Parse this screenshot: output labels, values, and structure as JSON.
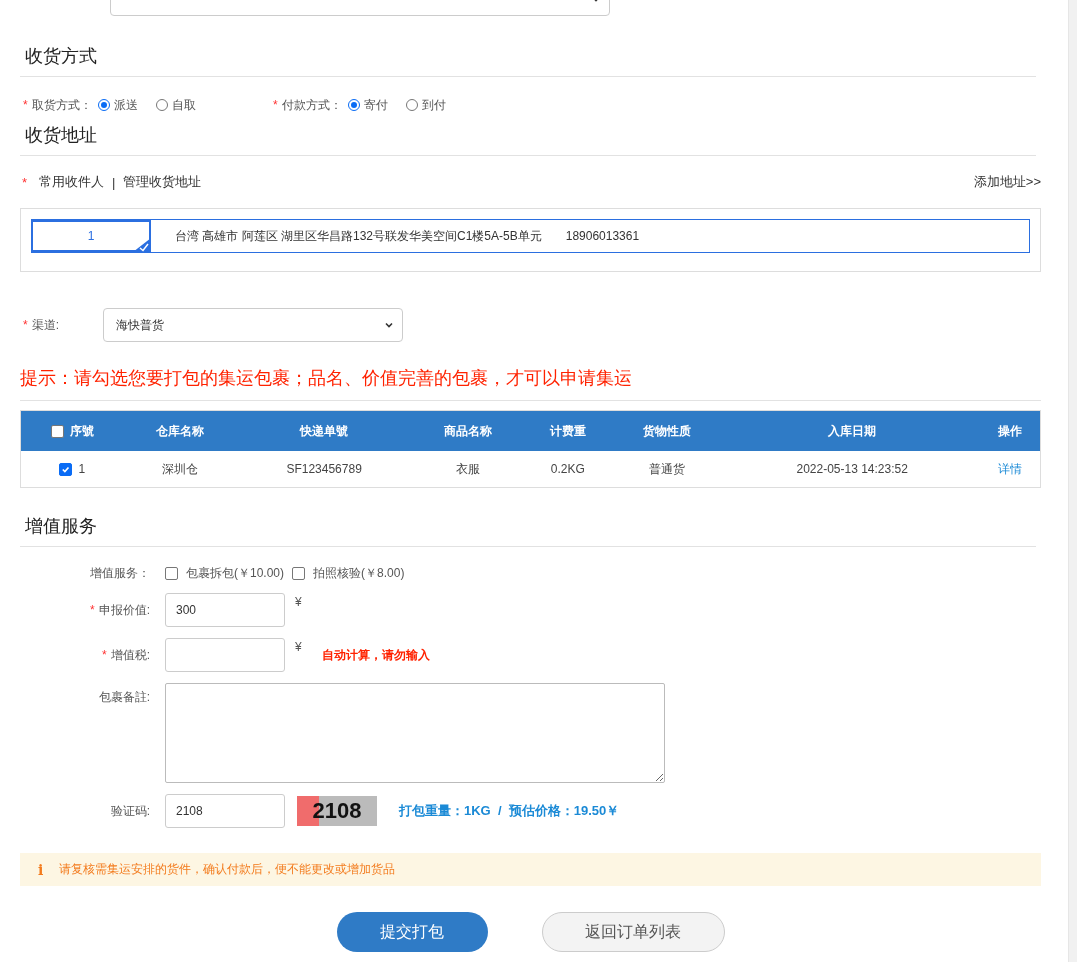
{
  "delivery": {
    "title": "收货方式",
    "fields": [
      {
        "mark": "*",
        "label": "取货方式：",
        "options": [
          {
            "label": "派送",
            "selected": true
          },
          {
            "label": "自取",
            "selected": false
          }
        ]
      },
      {
        "mark": "*",
        "label": "付款方式：",
        "options": [
          {
            "label": "寄付",
            "selected": true
          },
          {
            "label": "到付",
            "selected": false
          }
        ]
      }
    ]
  },
  "address": {
    "title": "收货地址",
    "mark": "*",
    "links": [
      "常用收件人",
      "管理收货地址"
    ],
    "separator": "|",
    "add_link": "添加地址>>",
    "entries": [
      {
        "index": "1",
        "text": "台湾 高雄市 阿莲区 湖里区华昌路132号联发华美空间C1楼5A-5B单元",
        "phone": "18906013361",
        "selected": true
      }
    ]
  },
  "channel": {
    "mark": "*",
    "label": "渠道:",
    "value": "海快普货"
  },
  "tip": "提示：请勾选您要打包的集运包裹；品名、价值完善的包裹，才可以申请集运",
  "table": {
    "select_all": false,
    "columns": [
      "序號",
      "仓库名称",
      "快递单號",
      "商品名称",
      "计费重",
      "货物性质",
      "入库日期",
      "操作"
    ],
    "rows": [
      {
        "checked": true,
        "cells": [
          "1",
          "深圳仓",
          "SF123456789",
          "衣服",
          "0.2KG",
          "普通货",
          "2022-05-13 14:23:52"
        ],
        "action": "详情"
      }
    ]
  },
  "services": {
    "title": "增值服务",
    "label": "增值服务：",
    "options": [
      {
        "label": "包裹拆包(￥10.00)",
        "checked": false
      },
      {
        "label": "拍照核验(￥8.00)",
        "checked": false
      }
    ],
    "declared": {
      "mark": "*",
      "label": "申报价值:",
      "value": "300",
      "unit": "¥"
    },
    "tax": {
      "mark": "*",
      "label": "增值税:",
      "unit": "¥",
      "note": "自动计算，请勿输入"
    },
    "remarks": {
      "label": "包裹备註:"
    },
    "captcha": {
      "label": "验证码:",
      "value": "2108",
      "image_text": "2108",
      "summary": "打包重量：1KG  /  预估价格：19.50￥"
    }
  },
  "notice": {
    "icon": "i",
    "text": "请复核需集运安排的货件，确认付款后，便不能更改或增加货品"
  },
  "buttons": [
    {
      "label": "提交打包",
      "kind": "primary"
    },
    {
      "label": "返回订单列表",
      "kind": "secondary"
    }
  ]
}
